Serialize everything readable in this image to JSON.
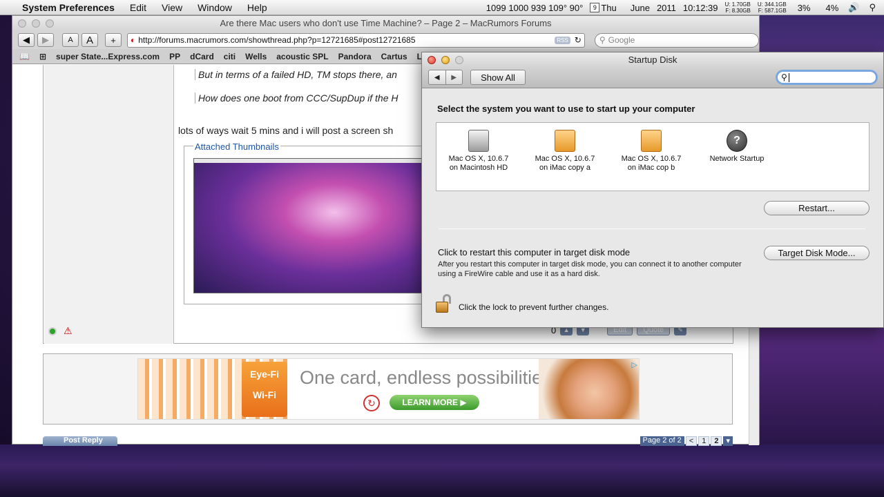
{
  "menubar": {
    "app_name": "System Preferences",
    "menus": [
      "Edit",
      "View",
      "Window",
      "Help"
    ],
    "stats": "1099 1000 939 109° 90°",
    "calendar_day": "9",
    "day": "Thu",
    "month": "June",
    "year": "2011",
    "time": "10:12:39",
    "disk_stats_a": "U: 1.70GB",
    "disk_stats_b": "F: 8.30GB",
    "disk_stats_c": "U: 344.1GB",
    "disk_stats_d": "F: 587.1GB",
    "cpu1": "3%",
    "cpu2": "4%"
  },
  "safari": {
    "title": "Are there Mac users who don't use Time Machine? – Page 2 – MacRumors Forums",
    "url": "http://forums.macrumors.com/showthread.php?p=12721685#post12721685",
    "rss_label": "RSS",
    "search_placeholder": "Google",
    "font_small": "A",
    "font_large": "A",
    "add_label": "+",
    "bookmarks": [
      "super State...Express.com",
      "PP",
      "dCard",
      "citi",
      "Wells",
      "acoustic SPL",
      "Pandora",
      "Cartus",
      "L"
    ],
    "quote1": "But in terms of a failed HD, TM stops there, an",
    "quote2": "How does one boot from CCC/SupDup if the H",
    "post_text": "lots of ways wait 5 mins and i will post a screen sh",
    "attached_label": "Attached Thumbnails",
    "vote_count": "0",
    "edit_label": "Edit",
    "quote_label": "Quote",
    "ad_tagline": "One card, endless possibilities.",
    "ad_learn_more": "LEARN MORE ▶",
    "ad_brand": "Eye-Fi",
    "ad_wifi": "Wi-Fi",
    "post_reply": "Post Reply",
    "page_label": "Page 2 of 2",
    "page_prev": "<",
    "page_1": "1",
    "page_2": "2"
  },
  "startup_disk": {
    "title": "Startup Disk",
    "show_all": "Show All",
    "heading": "Select the system you want to use to start up your computer",
    "disks": [
      {
        "line1": "Mac OS X, 10.6.7",
        "line2": "on Macintosh HD",
        "icon": "internal-hd-icon"
      },
      {
        "line1": "Mac OS X, 10.6.7",
        "line2": "on iMac copy a",
        "icon": "external-drive-icon"
      },
      {
        "line1": "Mac OS X, 10.6.7",
        "line2": "on iMac cop b",
        "icon": "external-drive-icon"
      },
      {
        "line1": "Network Startup",
        "line2": "",
        "icon": "network-startup-icon"
      }
    ],
    "restart_label": "Restart...",
    "tdm_title": "Click to restart this computer in target disk mode",
    "tdm_desc": "After you restart this computer in target disk mode, you can connect it to another computer using a FireWire cable and use it as a hard disk.",
    "tdm_button": "Target Disk Mode...",
    "lock_text": "Click the lock to prevent further changes."
  }
}
